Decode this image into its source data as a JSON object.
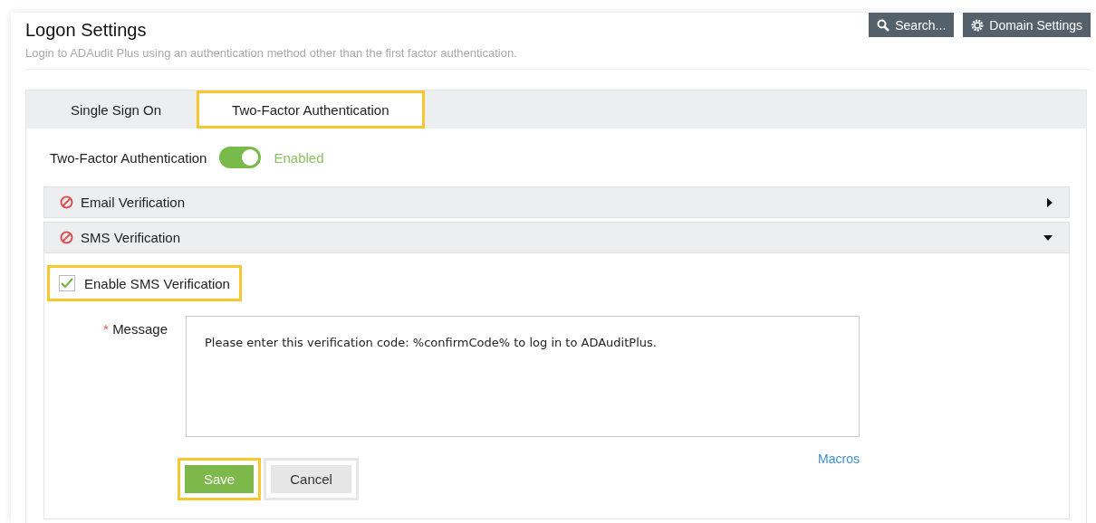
{
  "header": {
    "title": "Logon Settings",
    "subtitle": "Login to ADAudit Plus using an authentication method other than the first factor authentication."
  },
  "toolbar": [
    {
      "kind": "search",
      "label": "Search..."
    },
    {
      "kind": "settings",
      "label": "Domain Settings"
    }
  ],
  "tabs": [
    {
      "label": "Single Sign On",
      "selected": false,
      "highlighted": false
    },
    {
      "label": "Two-Factor Authentication",
      "selected": true,
      "highlighted": true
    }
  ],
  "two_factor": {
    "label": "Two-Factor Authentication",
    "on": true,
    "status": "Enabled"
  },
  "sections": [
    {
      "title": "Email Verification",
      "expanded": false
    },
    {
      "title": "SMS Verification",
      "expanded": true
    }
  ],
  "sms": {
    "checkbox": {
      "label": "Enable SMS Verification",
      "checked": true,
      "highlighted": true
    },
    "message": {
      "label": "Message",
      "required_mark": "*",
      "value": "Please enter this verification code: %confirmCode% to log in to ADAuditPlus."
    },
    "macros": "Macros",
    "buttons": [
      {
        "kind": "primary",
        "label": "Save",
        "highlighted": true
      },
      {
        "kind": "secondary",
        "label": "Cancel",
        "highlighted": false
      }
    ]
  }
}
